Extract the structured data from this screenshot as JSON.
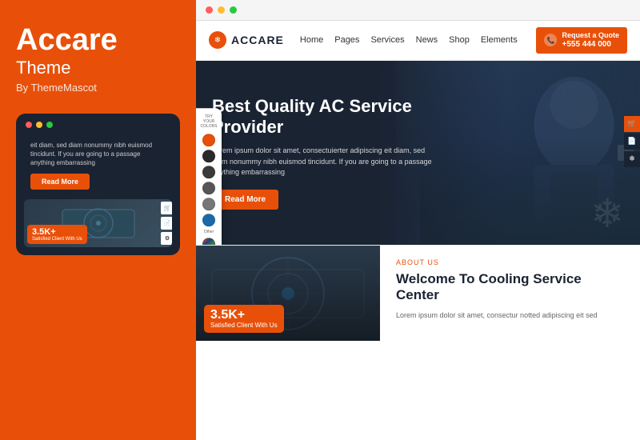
{
  "left": {
    "brand_title": "Accare",
    "brand_subtitle": "Theme",
    "brand_by": "By ThemeMascot",
    "dots": [
      "red",
      "yellow",
      "green"
    ],
    "mobile_text": "eit diam, sed diam nonummy nibh euismod tincidunt. If you are going to a passage anything embarrassing",
    "read_more": "Read More",
    "badge_num": "3.5K+",
    "badge_text": "Satisfied Client With Us"
  },
  "right": {
    "browser_dots": [
      "red",
      "yellow",
      "green"
    ],
    "nav": {
      "logo_icon": "❄",
      "logo_text": "ACCARE",
      "links": [
        "Home",
        "Pages",
        "Services",
        "News",
        "Shop",
        "Elements"
      ],
      "cta_label": "Request a Quote",
      "cta_phone": "+555 444 000"
    },
    "hero": {
      "title": "Best Quality AC Service Provider",
      "desc": "Lorem ipsum dolor sit amet, consectuierter adipiscing eit diam, sed diam nonummy nibh euismod tincidunt. If you are going to a passage anything embarrassing",
      "btn": "Read More",
      "arrow_left": "‹",
      "arrow_right": "›",
      "snowflake": "❄"
    },
    "color_picker": {
      "title": "TRY YOUR COLORS",
      "colors": [
        "#e8500a",
        "#2a2a2a",
        "#3a3a3a",
        "#555",
        "#777",
        "#e8c000"
      ],
      "other_label": "Other"
    },
    "bottom": {
      "about_label": "ABOUT US",
      "about_title": "Welcome To Cooling Service Center",
      "about_text": "Lorem ipsum dolor sit amet, consectur notted adipiscing eit sed",
      "badge_num": "3.5K+",
      "badge_text": "Satisfied Client With Us"
    }
  }
}
